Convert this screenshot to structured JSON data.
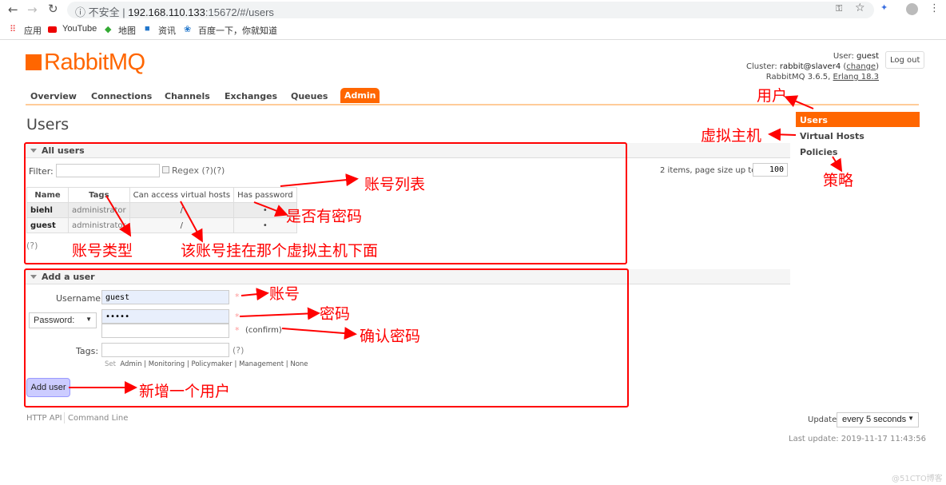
{
  "browser": {
    "not_secure": "不安全",
    "url_host": "192.168.110.133",
    "url_rest": ":15672/#/users",
    "bookmarks": [
      "应用",
      "YouTube",
      "地图",
      "资讯",
      "百度一下，你就知道"
    ]
  },
  "header": {
    "logo": "RabbitMQ",
    "user_label": "User:",
    "user": "guest",
    "cluster_label": "Cluster:",
    "cluster": "rabbit@slaver4",
    "change": "change",
    "version": "RabbitMQ 3.6.5,",
    "erlang": "Erlang 18.3",
    "logout": "Log out"
  },
  "nav": [
    "Overview",
    "Connections",
    "Channels",
    "Exchanges",
    "Queues",
    "Admin"
  ],
  "sidebar": [
    "Users",
    "Virtual Hosts",
    "Policies"
  ],
  "page_title": "Users",
  "all_users": {
    "title": "All users",
    "filter_label": "Filter:",
    "regex": "Regex",
    "help": "(?)(?)",
    "pagination": "2 items, page size up to",
    "page_size": "100",
    "columns": [
      "Name",
      "Tags",
      "Can access virtual hosts",
      "Has password"
    ],
    "rows": [
      [
        "biehl",
        "administrator",
        "/",
        "•"
      ],
      [
        "guest",
        "administrator",
        "/",
        "•"
      ]
    ],
    "footer_help": "(?)"
  },
  "add_user": {
    "title": "Add a user",
    "username_label": "Username:",
    "username": "guest",
    "password_select": "Password:",
    "password": "•••••",
    "confirm": "(confirm)",
    "tags_label": "Tags:",
    "tags_help": "(?)",
    "set": "Set",
    "tag_options": [
      "Admin",
      "Monitoring",
      "Policymaker",
      "Management",
      "None"
    ],
    "submit": "Add user",
    "required": "*"
  },
  "footer": {
    "links": [
      "HTTP API",
      "Command Line"
    ],
    "update_label": "Update",
    "update_value": "every 5 seconds",
    "last_update": "Last update: 2019-11-17 11:43:56"
  },
  "watermark": "@51CTO博客",
  "annotations": {
    "users": "用户",
    "vhosts": "虚拟主机",
    "policies": "策略",
    "user_list": "账号列表",
    "has_password": "是否有密码",
    "tags": "账号类型",
    "vhost_access": "该账号挂在那个虚拟主机下面",
    "username": "账号",
    "password": "密码",
    "confirm": "确认密码",
    "add": "新增一个用户"
  },
  "colors": {
    "accent": "#ff6600",
    "annotation": "#ff0000"
  }
}
